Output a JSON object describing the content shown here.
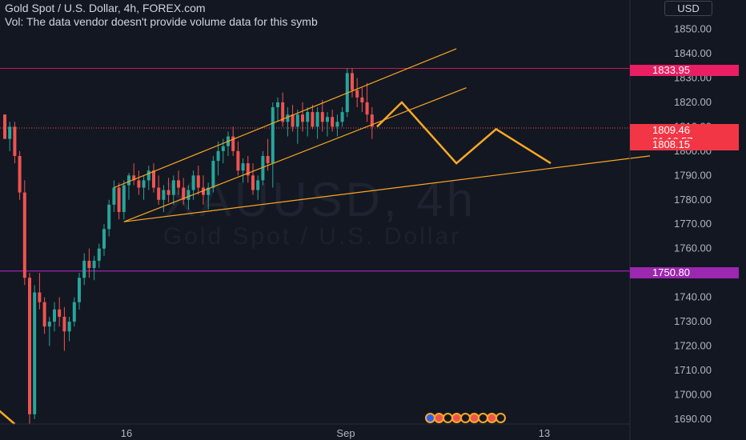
{
  "header": {
    "title": "Gold Spot / U.S. Dollar, 4h, FOREX.com",
    "volume_note": "Vol: The data vendor doesn't provide volume data for this symb"
  },
  "watermark": {
    "symbol": "XAUUSD, 4h",
    "name": "Gold Spot / U.S. Dollar"
  },
  "currency_button": "USD",
  "colors": {
    "background": "#131722",
    "up": "#26a69a",
    "down": "#ef5350",
    "drawing": "#f9a825",
    "resistance_line": "#e91e63",
    "support_line": "#9c27b0"
  },
  "price_tags": {
    "resistance": "1833.95",
    "current": "1809.46",
    "countdown": "01:16:57",
    "bid": "1808.15",
    "support": "1750.80"
  },
  "chart_data": {
    "type": "candlestick",
    "instrument": "XAUUSD",
    "timeframe": "4h",
    "y_ticks": [
      1850.0,
      1840.0,
      1830.0,
      1820.0,
      1810.0,
      1800.0,
      1790.0,
      1780.0,
      1770.0,
      1760.0,
      1750.0,
      1740.0,
      1730.0,
      1720.0,
      1710.0,
      1700.0,
      1690.0
    ],
    "y_tick_labels": [
      "1850.00",
      "1840.00",
      "1830.00",
      "1820.00",
      "1810.00",
      "1800.00",
      "1790.00",
      "1780.00",
      "1770.00",
      "1760.00",
      "1750.00",
      "1740.00",
      "1730.00",
      "1720.00",
      "1710.00",
      "1700.00",
      "1690.00"
    ],
    "ylim": [
      1688,
      1862
    ],
    "x_tick_labels": [
      "16",
      "Sep",
      "13"
    ],
    "candles": [
      [
        1815,
        1815,
        1805,
        1805
      ],
      [
        1805,
        1812,
        1800,
        1810
      ],
      [
        1810,
        1812,
        1795,
        1798
      ],
      [
        1798,
        1800,
        1780,
        1783
      ],
      [
        1783,
        1788,
        1745,
        1748
      ],
      [
        1748,
        1750,
        1688,
        1692
      ],
      [
        1692,
        1745,
        1690,
        1742
      ],
      [
        1742,
        1750,
        1735,
        1738
      ],
      [
        1738,
        1740,
        1725,
        1728
      ],
      [
        1728,
        1732,
        1720,
        1730
      ],
      [
        1730,
        1738,
        1726,
        1735
      ],
      [
        1735,
        1740,
        1728,
        1732
      ],
      [
        1732,
        1736,
        1718,
        1726
      ],
      [
        1726,
        1732,
        1722,
        1730
      ],
      [
        1730,
        1740,
        1728,
        1738
      ],
      [
        1738,
        1750,
        1735,
        1748
      ],
      [
        1748,
        1758,
        1745,
        1755
      ],
      [
        1755,
        1760,
        1748,
        1752
      ],
      [
        1752,
        1757,
        1747,
        1755
      ],
      [
        1755,
        1762,
        1752,
        1760
      ],
      [
        1760,
        1770,
        1757,
        1768
      ],
      [
        1768,
        1780,
        1765,
        1778
      ],
      [
        1778,
        1788,
        1775,
        1785
      ],
      [
        1785,
        1787,
        1772,
        1775
      ],
      [
        1775,
        1788,
        1772,
        1786
      ],
      [
        1786,
        1791,
        1780,
        1790
      ],
      [
        1790,
        1795,
        1786,
        1788
      ],
      [
        1788,
        1792,
        1782,
        1785
      ],
      [
        1785,
        1790,
        1780,
        1788
      ],
      [
        1788,
        1794,
        1784,
        1792
      ],
      [
        1792,
        1795,
        1783,
        1785
      ],
      [
        1785,
        1790,
        1778,
        1780
      ],
      [
        1780,
        1786,
        1775,
        1784
      ],
      [
        1784,
        1789,
        1779,
        1782
      ],
      [
        1782,
        1790,
        1778,
        1788
      ],
      [
        1788,
        1792,
        1782,
        1785
      ],
      [
        1785,
        1789,
        1778,
        1780
      ],
      [
        1780,
        1786,
        1776,
        1784
      ],
      [
        1784,
        1792,
        1780,
        1790
      ],
      [
        1790,
        1794,
        1782,
        1785
      ],
      [
        1785,
        1790,
        1778,
        1782
      ],
      [
        1782,
        1787,
        1776,
        1785
      ],
      [
        1785,
        1798,
        1783,
        1796
      ],
      [
        1796,
        1804,
        1790,
        1800
      ],
      [
        1800,
        1805,
        1795,
        1802
      ],
      [
        1802,
        1808,
        1798,
        1806
      ],
      [
        1806,
        1810,
        1798,
        1800
      ],
      [
        1800,
        1804,
        1790,
        1792
      ],
      [
        1792,
        1797,
        1787,
        1795
      ],
      [
        1795,
        1798,
        1787,
        1790
      ],
      [
        1790,
        1795,
        1782,
        1784
      ],
      [
        1784,
        1790,
        1780,
        1788
      ],
      [
        1788,
        1800,
        1786,
        1798
      ],
      [
        1798,
        1805,
        1792,
        1795
      ],
      [
        1795,
        1820,
        1785,
        1818
      ],
      [
        1818,
        1822,
        1812,
        1820
      ],
      [
        1820,
        1824,
        1810,
        1812
      ],
      [
        1812,
        1818,
        1806,
        1815
      ],
      [
        1815,
        1819,
        1808,
        1810
      ],
      [
        1810,
        1817,
        1803,
        1815
      ],
      [
        1815,
        1820,
        1808,
        1812
      ],
      [
        1812,
        1818,
        1806,
        1816
      ],
      [
        1816,
        1819,
        1809,
        1810
      ],
      [
        1810,
        1818,
        1805,
        1816
      ],
      [
        1816,
        1821,
        1808,
        1812
      ],
      [
        1812,
        1816,
        1806,
        1814
      ],
      [
        1814,
        1817,
        1808,
        1810
      ],
      [
        1810,
        1815,
        1806,
        1812
      ],
      [
        1812,
        1818,
        1810,
        1816
      ],
      [
        1816,
        1834,
        1814,
        1832
      ],
      [
        1832,
        1834,
        1822,
        1825
      ],
      [
        1825,
        1830,
        1818,
        1822
      ],
      [
        1822,
        1826,
        1816,
        1820
      ],
      [
        1820,
        1828,
        1812,
        1815
      ],
      [
        1815,
        1818,
        1805,
        1810
      ]
    ],
    "drawings": [
      {
        "name": "upper-channel-line",
        "points": [
          [
            22,
            1785
          ],
          [
            91,
            1842
          ]
        ]
      },
      {
        "name": "lower-channel-line",
        "points": [
          [
            24,
            1771
          ],
          [
            93,
            1826
          ]
        ]
      },
      {
        "name": "long-support-line",
        "points": [
          [
            24,
            1771
          ],
          [
            130,
            1798
          ]
        ]
      },
      {
        "name": "projected-path",
        "points": [
          [
            75,
            1810
          ],
          [
            80,
            1820
          ],
          [
            91,
            1795
          ],
          [
            99,
            1809
          ],
          [
            110,
            1795
          ]
        ]
      },
      {
        "name": "left-edge-projection",
        "points": [
          [
            -2,
            1695
          ],
          [
            2,
            1688
          ]
        ]
      }
    ],
    "hlines": {
      "resistance": 1833.95,
      "support": 1750.8,
      "current": 1809.46
    }
  }
}
